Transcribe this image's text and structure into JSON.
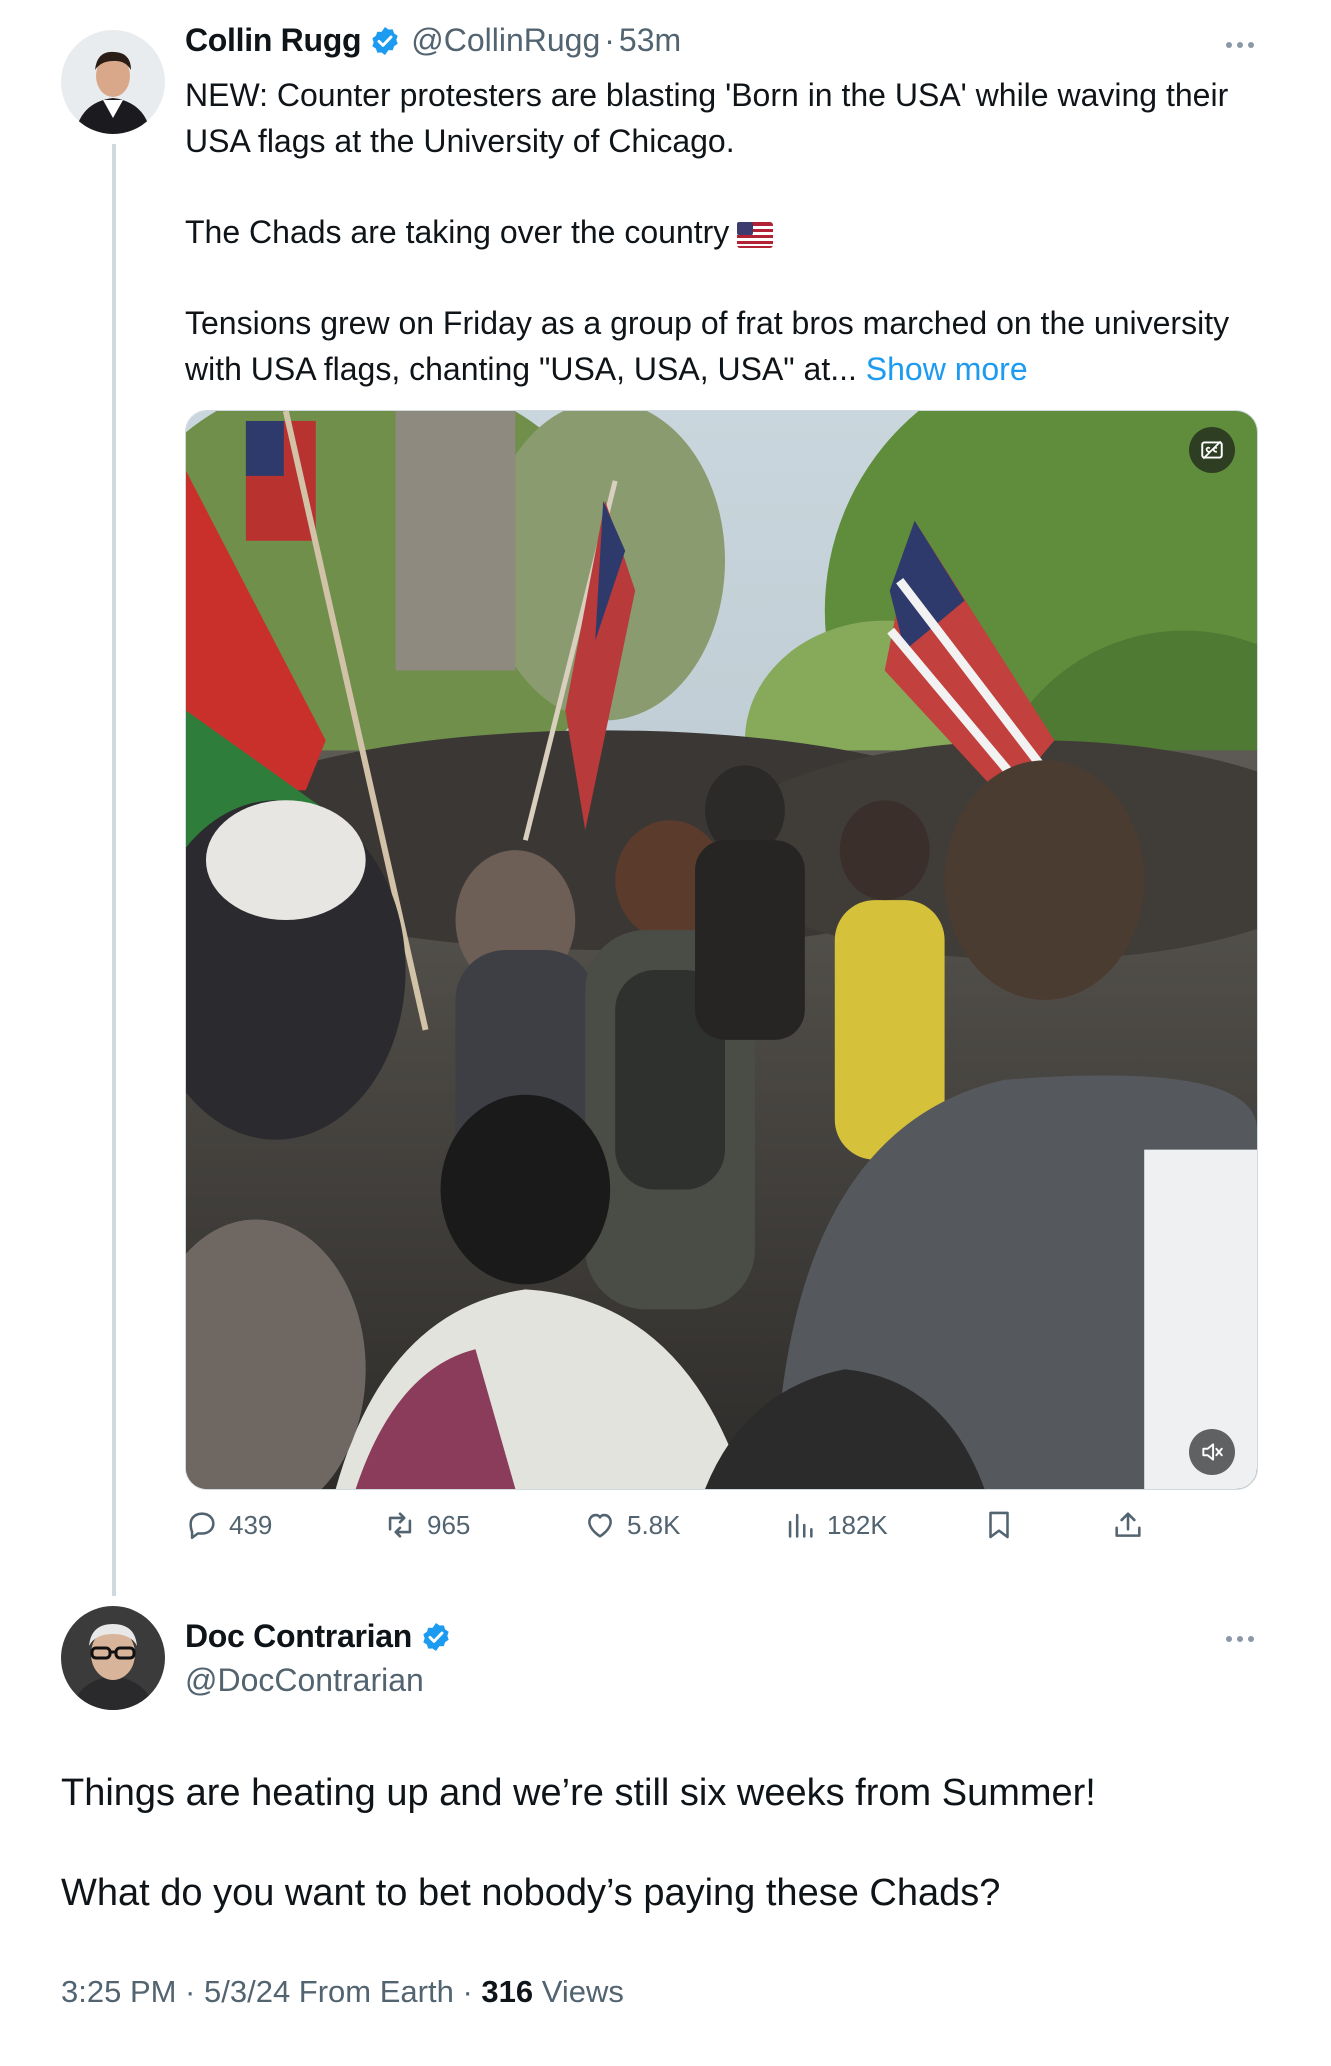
{
  "post": {
    "author_name": "Collin Rugg",
    "handle": "@CollinRugg",
    "separator": "·",
    "time": "53m",
    "text_p1": "NEW: Counter protesters are blasting 'Born in the USA' while waving their USA flags at the University of Chicago.",
    "text_p2": "The Chads are taking over the country",
    "text_p2_emoji": "flag-usa-icon",
    "text_p3": "Tensions grew on Friday as a group of frat bros marched on the university with USA flags, chanting \"USA, USA, USA\" at...",
    "show_more": "Show more",
    "media": {
      "type": "video",
      "caption_button_icon": "closed-captions-icon",
      "mute_button_icon": "speaker-muted-icon"
    },
    "stats": {
      "replies": "439",
      "reposts": "965",
      "likes": "5.8K",
      "views": "182K"
    }
  },
  "reply": {
    "author_name": "Doc Contrarian",
    "handle": "@DocContrarian",
    "text_p1": "Things are heating up and we’re still six weeks from Summer!",
    "text_p2": "What do you want to bet nobody’s paying these Chads?",
    "timestamp": "3:25 PM · 5/3/24 From Earth ·",
    "views_count": "316",
    "views_label": "Views"
  },
  "colors": {
    "text_primary": "#0f1419",
    "text_secondary": "#536471",
    "link": "#1d9bf0",
    "verified": "#1d9bf0",
    "thread_line": "#cfd9de"
  }
}
